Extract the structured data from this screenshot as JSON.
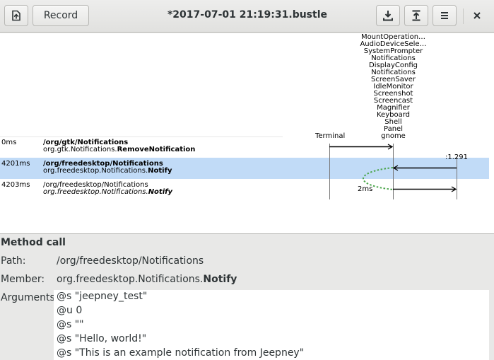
{
  "header": {
    "title": "*2017-07-01 21:19:31.bustle",
    "record_label": "Record"
  },
  "diagram": {
    "endpoint_terminal": "Terminal",
    "gnome_names": [
      "MountOperation…",
      "AudioDeviceSele…",
      "SystemPrompter",
      "Notifications",
      "DisplayConfig",
      "Notifications",
      "ScreenSaver",
      "IdleMonitor",
      "Screenshot",
      "Screencast",
      "Magnifier",
      "Keyboard",
      "Shell",
      "Panel",
      "gnome"
    ],
    "return_sender": ":1.291",
    "duration_label": "2ms",
    "messages": [
      {
        "time": "0ms",
        "path": "/org/gtk/Notifications",
        "member_prefix": "org.gtk.Notifications.",
        "member_name": "RemoveNotification"
      },
      {
        "time": "4201ms",
        "path": "/org/freedesktop/Notifications",
        "member_prefix": "org.freedesktop.Notifications.",
        "member_name": "Notify"
      },
      {
        "time": "4203ms",
        "path": "/org/freedesktop/Notifications",
        "member_prefix": "org.freedesktop.Notifications.",
        "member_name": "Notify"
      }
    ],
    "colors": {
      "selected_row": "#c1dbf7",
      "duration_arc": "#4ca64c"
    }
  },
  "details": {
    "heading": "Method call",
    "path_key": "Path:",
    "path_value": "/org/freedesktop/Notifications",
    "member_key": "Member:",
    "member_prefix": "org.freedesktop.Notifications.",
    "member_name": "Notify",
    "arguments_key": "Arguments:",
    "arguments": [
      "@s \"jeepney_test\"",
      "@u 0",
      "@s \"\"",
      "@s \"Hello, world!\"",
      "@s \"This is an example notification from Jeepney\""
    ]
  },
  "icons": {
    "open": "open-file-icon",
    "save": "download-icon",
    "export": "upload-icon",
    "menu": "hamburger-menu-icon",
    "close": "close-icon"
  }
}
